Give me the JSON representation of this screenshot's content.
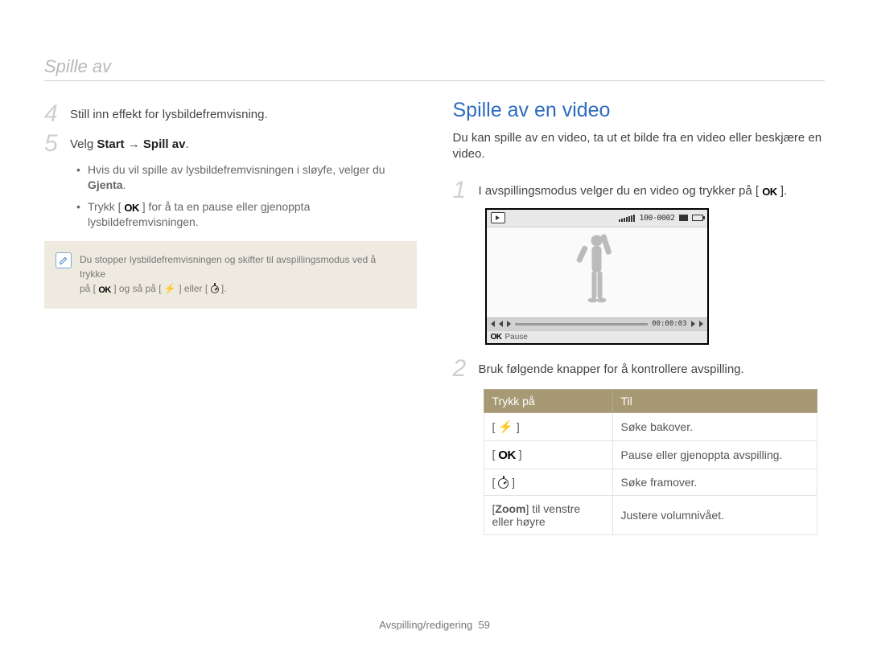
{
  "header": "Spille av",
  "left": {
    "step4": {
      "num": "4",
      "text": "Still inn effekt for lysbildefremvisning."
    },
    "step5": {
      "num": "5",
      "pre": "Velg ",
      "bold1": "Start",
      "arrow": " → ",
      "bold2": "Spill av",
      "post": ".",
      "bullet1a": "Hvis du vil spille av lysbildefremvisningen i sløyfe, velger du ",
      "bullet1b": "Gjenta",
      "bullet1c": ".",
      "bullet2a": "Trykk [ ",
      "bullet2b": " ] for å ta en pause eller gjenoppta lysbildefremvisningen."
    },
    "note": {
      "line1": "Du stopper lysbildefremvisningen og skifter til avspillingsmodus ved å trykke",
      "line2a": "på [ ",
      "line2b": " ] og så på [ ",
      "line2c": " ] eller [ ",
      "line2d": " ]."
    }
  },
  "right": {
    "title": "Spille av en video",
    "intro": "Du kan spille av en video, ta ut et bilde fra en video eller beskjære en video.",
    "step1": {
      "num": "1",
      "pre": "I avspillingsmodus velger du en video og trykker på [ ",
      "post": " ]."
    },
    "screen": {
      "top_counter": "100-0002",
      "time": "00:00:03",
      "bottom_ok": "OK",
      "bottom_text": "Pause"
    },
    "step2": {
      "num": "2",
      "text": "Bruk følgende knapper for å kontrollere avspilling."
    },
    "table": {
      "h1": "Trykk på",
      "h2": "Til",
      "r1": {
        "c2": "Søke bakover."
      },
      "r2": {
        "c2": "Pause eller gjenoppta avspilling."
      },
      "r3": {
        "c2": "Søke framover."
      },
      "r4": {
        "c1a": "[",
        "c1b": "Zoom",
        "c1c": "] til venstre eller høyre",
        "c2": "Justere volumnivået."
      }
    }
  },
  "footer": {
    "section": "Avspilling/redigering",
    "page": "59"
  },
  "icons": {
    "ok": "OK",
    "flash": "⚡"
  }
}
